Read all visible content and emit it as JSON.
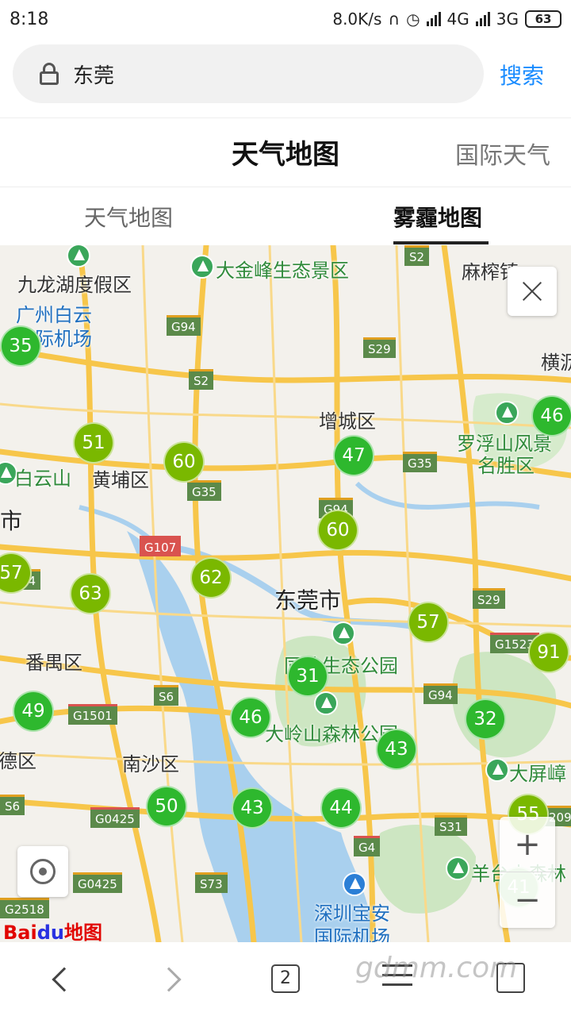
{
  "status": {
    "time": "8:18",
    "speed": "8.0K/s",
    "net1": "4G",
    "net2": "3G",
    "battery": "63"
  },
  "search": {
    "query": "东莞",
    "button": "搜索"
  },
  "header": {
    "title": "天气地图",
    "intl": "国际天气"
  },
  "tabs": [
    {
      "label": "天气地图"
    },
    {
      "label": "雾霾地图"
    }
  ],
  "map": {
    "aqi": [
      {
        "value": "35"
      },
      {
        "value": "51"
      },
      {
        "value": "60"
      },
      {
        "value": "47"
      },
      {
        "value": "46"
      },
      {
        "value": "60"
      },
      {
        "value": "57"
      },
      {
        "value": "63"
      },
      {
        "value": "62"
      },
      {
        "value": "57"
      },
      {
        "value": "91"
      },
      {
        "value": "31"
      },
      {
        "value": "49"
      },
      {
        "value": "46"
      },
      {
        "value": "43"
      },
      {
        "value": "32"
      },
      {
        "value": "50"
      },
      {
        "value": "43"
      },
      {
        "value": "44"
      },
      {
        "value": "55"
      },
      {
        "value": "41"
      }
    ],
    "places": [
      {
        "name": "九龙湖度假区"
      },
      {
        "name": "大金峰生态景区"
      },
      {
        "name": "麻榨镇"
      },
      {
        "name": "广州白云"
      },
      {
        "name": "国际机场"
      },
      {
        "name": "横沥"
      },
      {
        "name": "增城区"
      },
      {
        "name": "罗浮山风景"
      },
      {
        "name": "名胜区"
      },
      {
        "name": "白云山"
      },
      {
        "name": "黄埔区"
      },
      {
        "name": "市"
      },
      {
        "name": "东莞市"
      },
      {
        "name": "番禺区"
      },
      {
        "name": "同沙生态公园"
      },
      {
        "name": "大岭山森林公园"
      },
      {
        "name": "大屏嶂"
      },
      {
        "name": "南沙区"
      },
      {
        "name": "德区"
      },
      {
        "name": "深圳宝安"
      },
      {
        "name": "国际机场"
      },
      {
        "name": "羊台山森林"
      }
    ],
    "roads": [
      {
        "name": "S2"
      },
      {
        "name": "G94"
      },
      {
        "name": "S29"
      },
      {
        "name": "S2"
      },
      {
        "name": "G35"
      },
      {
        "name": "G35"
      },
      {
        "name": "G94"
      },
      {
        "name": "G107"
      },
      {
        "name": "S29"
      },
      {
        "name": "G1523"
      },
      {
        "name": "G94"
      },
      {
        "name": "S6"
      },
      {
        "name": "G1501"
      },
      {
        "name": "S6"
      },
      {
        "name": "G0425"
      },
      {
        "name": "S31"
      },
      {
        "name": "G4"
      },
      {
        "name": "G0425"
      },
      {
        "name": "S73"
      },
      {
        "name": "G2518"
      },
      {
        "name": "209"
      },
      {
        "name": "54"
      }
    ],
    "logo": "Bai",
    "logo2": "du",
    "logo3": "地图",
    "zoom_in": "+",
    "zoom_out": "−"
  },
  "nav": {
    "tabs_count": "2",
    "watermark": "gdmm.com"
  },
  "colors": {
    "accent": "#1a8cff",
    "aqi_good": "#2eb82e",
    "aqi_moderate": "#7ab800"
  }
}
